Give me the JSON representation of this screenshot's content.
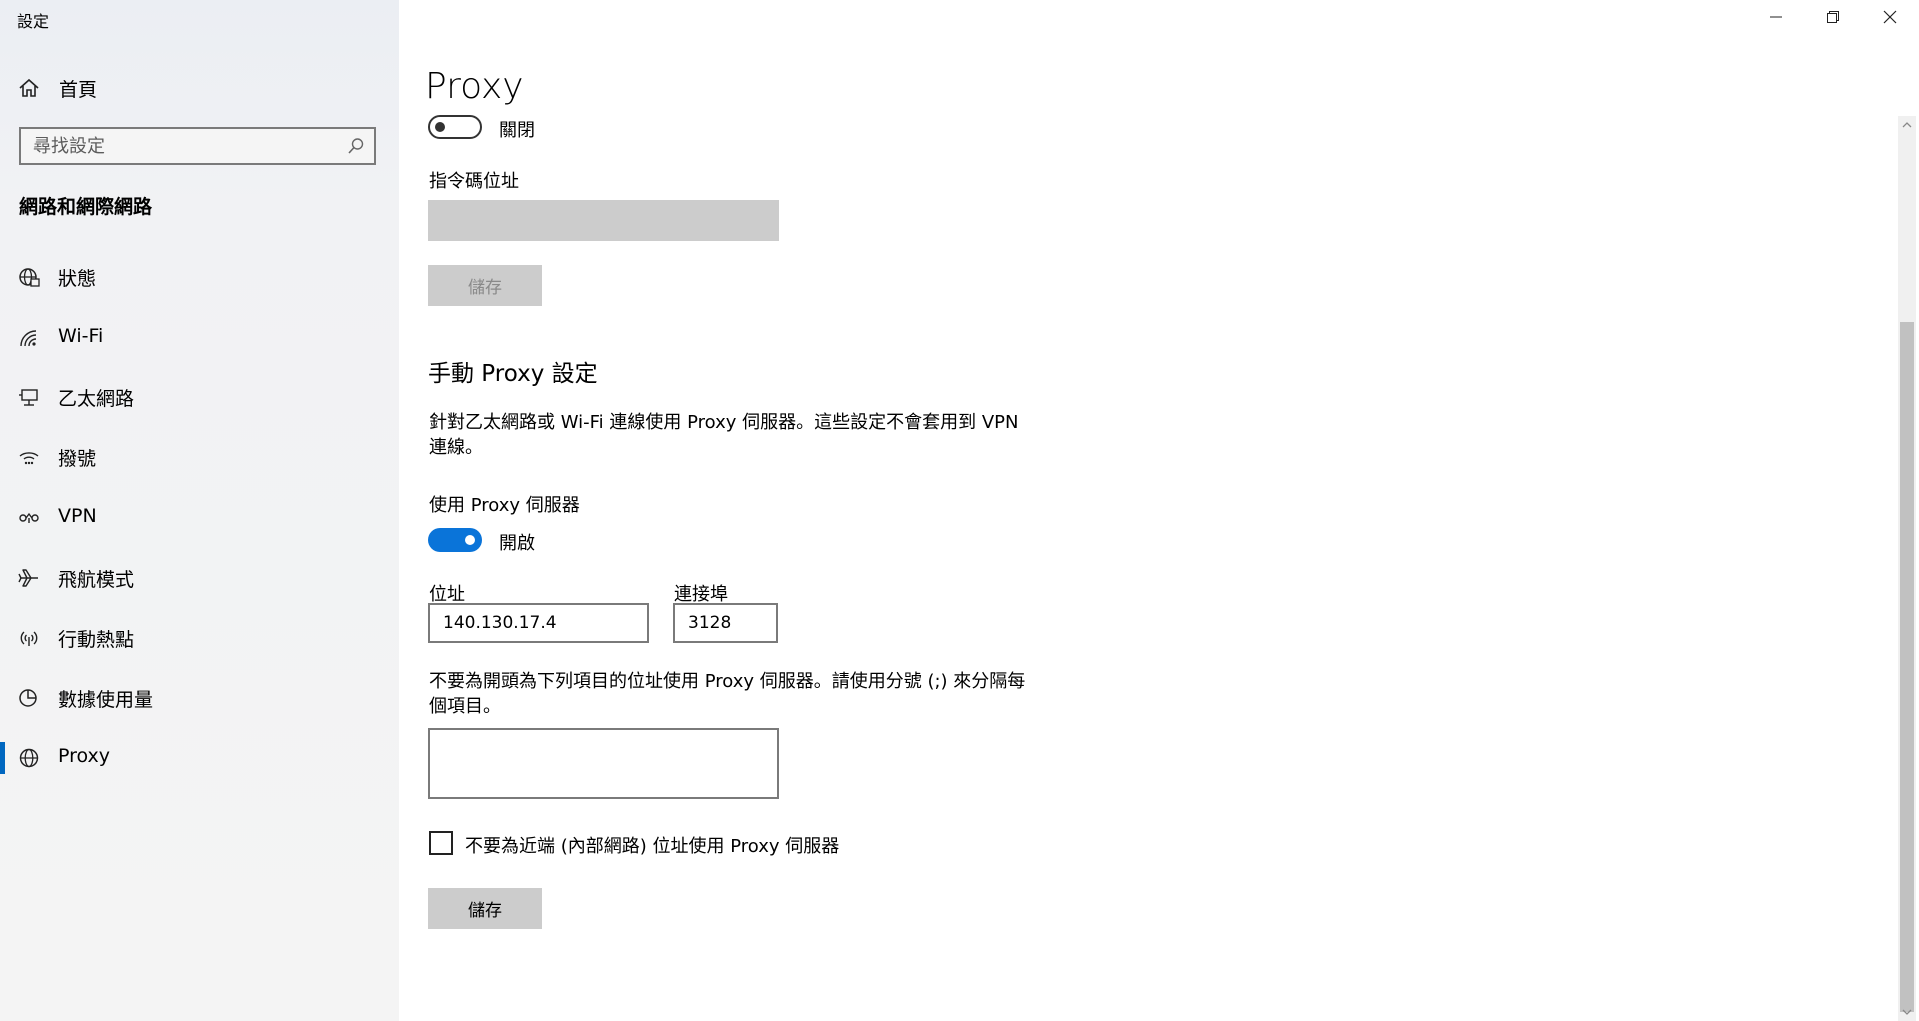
{
  "window": {
    "title": "設定"
  },
  "sidebar": {
    "home_label": "首頁",
    "search_placeholder": "尋找設定",
    "section_title": "網路和網際網路",
    "items": [
      {
        "label": "狀態",
        "icon": "globe-status-icon"
      },
      {
        "label": "Wi-Fi",
        "icon": "wifi-icon"
      },
      {
        "label": "乙太網路",
        "icon": "ethernet-icon"
      },
      {
        "label": "撥號",
        "icon": "dialup-icon"
      },
      {
        "label": "VPN",
        "icon": "vpn-icon"
      },
      {
        "label": "飛航模式",
        "icon": "airplane-icon"
      },
      {
        "label": "行動熱點",
        "icon": "hotspot-icon"
      },
      {
        "label": "數據使用量",
        "icon": "data-usage-icon"
      },
      {
        "label": "Proxy",
        "icon": "globe-icon",
        "active": true
      }
    ]
  },
  "main": {
    "title": "Proxy",
    "auto_setup": {
      "script_toggle_state": "關閉",
      "script_address_label": "指令碼位址",
      "script_address_value": "",
      "save_label": "儲存"
    },
    "manual": {
      "heading": "手動 Proxy 設定",
      "description": "針對乙太網路或 Wi-Fi 連線使用 Proxy 伺服器。這些設定不會套用到 VPN 連線。",
      "use_proxy_label": "使用 Proxy 伺服器",
      "use_proxy_state": "開啟",
      "address_label": "位址",
      "address_value": "140.130.17.4",
      "port_label": "連接埠",
      "port_value": "3128",
      "exceptions_label": "不要為開頭為下列項目的位址使用 Proxy 伺服器。請使用分號 (;) 來分隔每個項目。",
      "exceptions_value": "",
      "local_checkbox_label": "不要為近端 (內部網路) 位址使用 Proxy 伺服器",
      "local_checkbox_checked": false,
      "save_label": "儲存"
    }
  },
  "colors": {
    "accent": "#0a74d9",
    "sidebar_bg": "#f2f2f2",
    "disabled": "#cccccc"
  }
}
